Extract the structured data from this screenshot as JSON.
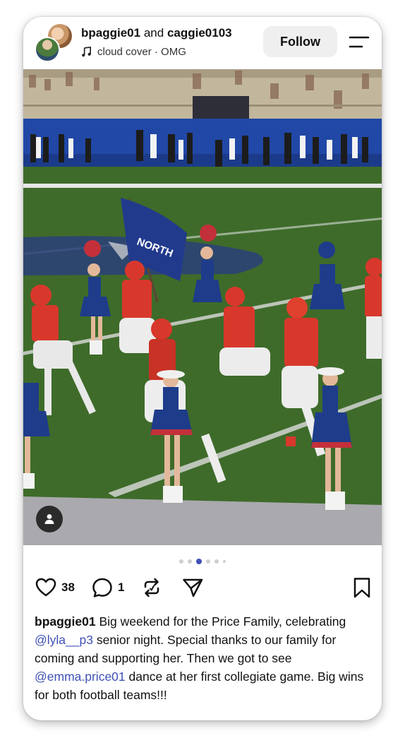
{
  "header": {
    "user1": "bpaggie01",
    "joiner": "and",
    "user2": "caggie0103",
    "music_icon": "music-note-icon",
    "music": "cloud cover · OMG",
    "follow_label": "Follow",
    "menu_icon": "menu-icon"
  },
  "media": {
    "description_icon": "person-tag-icon",
    "flag_text": "NORTH"
  },
  "carousel": {
    "dot_count": 6,
    "active_index": 2
  },
  "actions": {
    "likes": "38",
    "comments": "1",
    "like_icon": "heart-icon",
    "comment_icon": "comment-icon",
    "repost_icon": "repost-icon",
    "share_icon": "send-icon",
    "save_icon": "bookmark-icon"
  },
  "caption": {
    "username": "bpaggie01",
    "text_1": "Big weekend for the Price Family, celebrating ",
    "mention_1": "@lyla__p3",
    "text_2": " senior night.  Special thanks to our family for coming and supporting her.  Then we got to see ",
    "mention_2": "@emma.price01",
    "text_3": " dance at her first collegiate game.  Big wins for both football teams!!!"
  },
  "colors": {
    "mention": "#3f51b5",
    "follow_bg": "#efefef"
  }
}
